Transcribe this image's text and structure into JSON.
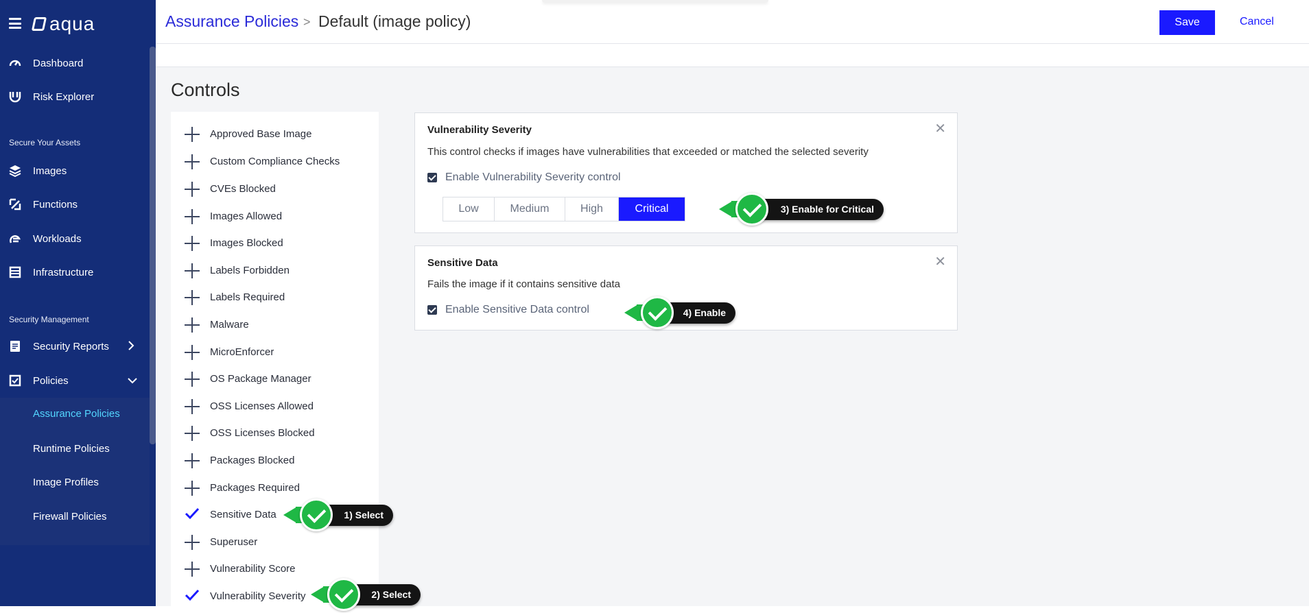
{
  "app": {
    "logo_text": "aqua"
  },
  "sidebar": {
    "primary": [
      {
        "label": "Dashboard",
        "icon": "dashboard-gauge-icon"
      },
      {
        "label": "Risk Explorer",
        "icon": "risk-explorer-icon"
      }
    ],
    "section_secure": "Secure Your Assets",
    "secure_items": [
      {
        "label": "Images",
        "icon": "layers-icon"
      },
      {
        "label": "Functions",
        "icon": "functions-icon"
      },
      {
        "label": "Workloads",
        "icon": "workloads-icon"
      },
      {
        "label": "Infrastructure",
        "icon": "infrastructure-icon"
      }
    ],
    "section_security": "Security Management",
    "security_items": [
      {
        "label": "Security Reports",
        "icon": "reports-icon",
        "expanded": false
      },
      {
        "label": "Policies",
        "icon": "policies-icon",
        "expanded": true
      }
    ],
    "policies_sub": [
      {
        "label": "Assurance Policies",
        "active": true
      },
      {
        "label": "Runtime Policies",
        "active": false
      },
      {
        "label": "Image Profiles",
        "active": false
      },
      {
        "label": "Firewall Policies",
        "active": false
      }
    ]
  },
  "header": {
    "breadcrumb_parent": "Assurance Policies",
    "breadcrumb_separator": ">",
    "breadcrumb_current": "Default (image policy)",
    "save_label": "Save",
    "cancel_label": "Cancel"
  },
  "main": {
    "title": "Controls",
    "controls": [
      {
        "label": "Approved Base Image",
        "selected": false
      },
      {
        "label": "Custom Compliance Checks",
        "selected": false
      },
      {
        "label": "CVEs Blocked",
        "selected": false
      },
      {
        "label": "Images Allowed",
        "selected": false
      },
      {
        "label": "Images Blocked",
        "selected": false
      },
      {
        "label": "Labels Forbidden",
        "selected": false
      },
      {
        "label": "Labels Required",
        "selected": false
      },
      {
        "label": "Malware",
        "selected": false
      },
      {
        "label": "MicroEnforcer",
        "selected": false
      },
      {
        "label": "OS Package Manager",
        "selected": false
      },
      {
        "label": "OSS Licenses Allowed",
        "selected": false
      },
      {
        "label": "OSS Licenses Blocked",
        "selected": false
      },
      {
        "label": "Packages Blocked",
        "selected": false
      },
      {
        "label": "Packages Required",
        "selected": false
      },
      {
        "label": "Sensitive Data",
        "selected": true
      },
      {
        "label": "Superuser",
        "selected": false
      },
      {
        "label": "Vulnerability Score",
        "selected": false
      },
      {
        "label": "Vulnerability Severity",
        "selected": true
      }
    ],
    "cards": {
      "vuln": {
        "title": "Vulnerability Severity",
        "description": "This control checks if images have vulnerabilities that exceeded or matched the selected severity",
        "enable_label": "Enable Vulnerability Severity control",
        "enabled": true,
        "severities": [
          "Low",
          "Medium",
          "High",
          "Critical"
        ],
        "selected_severity": "Critical"
      },
      "sensitive": {
        "title": "Sensitive Data",
        "description": "Fails the image if it contains sensitive data",
        "enable_label": "Enable Sensitive Data control",
        "enabled": true
      }
    }
  },
  "callouts": {
    "c1": "1) Select",
    "c2": "2) Select",
    "c3": "3) Enable for Critical",
    "c4": "4) Enable"
  },
  "colors": {
    "sidebar_bg": "#142d78",
    "accent_blue": "#1a1aff",
    "active_link": "#53d6ff",
    "callout_green": "#1fb845"
  }
}
